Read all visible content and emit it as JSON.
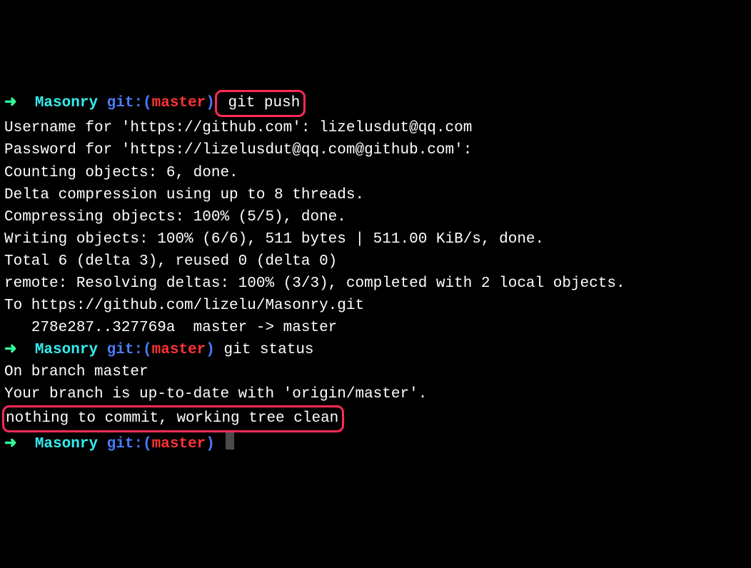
{
  "prompt1": {
    "arrow": "➜",
    "dir": "Masonry",
    "gitlbl": "git:(",
    "branch": "master",
    "paren": ")",
    "cmd": " git push"
  },
  "output1": {
    "l1": "Username for 'https://github.com': lizelusdut@qq.com",
    "l2": "Password for 'https://lizelusdut@qq.com@github.com':",
    "l3": "Counting objects: 6, done.",
    "l4": "Delta compression using up to 8 threads.",
    "l5": "Compressing objects: 100% (5/5), done.",
    "l6": "Writing objects: 100% (6/6), 511 bytes | 511.00 KiB/s, done.",
    "l7": "Total 6 (delta 3), reused 0 (delta 0)",
    "l8": "remote: Resolving deltas: 100% (3/3), completed with 2 local objects.",
    "l9": "To https://github.com/lizelu/Masonry.git",
    "l10": "   278e287..327769a  master -> master"
  },
  "prompt2": {
    "arrow": "➜",
    "dir": "Masonry",
    "gitlbl": "git:(",
    "branch": "master",
    "paren": ")",
    "cmd": " git status"
  },
  "output2": {
    "l1": "On branch master",
    "l2": "Your branch is up-to-date with 'origin/master'.",
    "l3": "",
    "l4": "nothing to commit, working tree clean"
  },
  "prompt3": {
    "arrow": "➜",
    "dir": "Masonry",
    "gitlbl": "git:(",
    "branch": "master",
    "paren": ")"
  }
}
